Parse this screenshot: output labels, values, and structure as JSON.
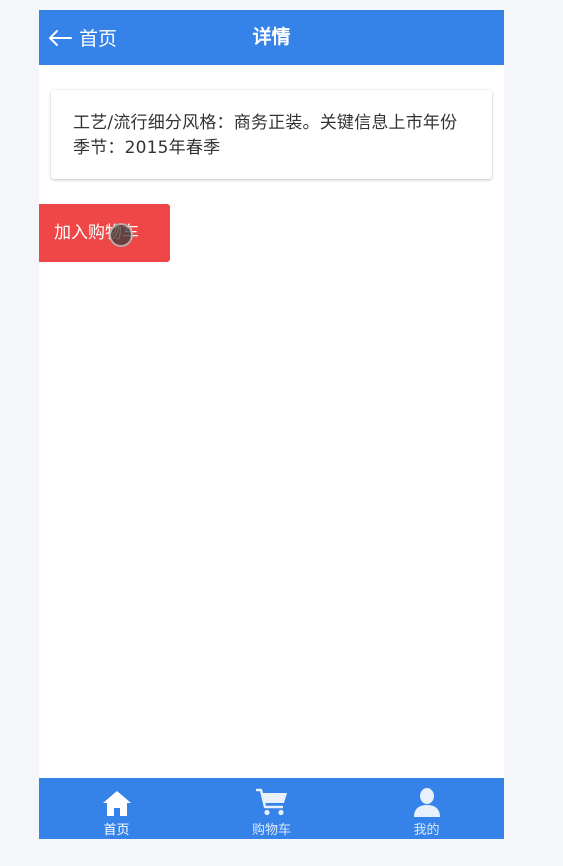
{
  "navbar": {
    "back_label": "首页",
    "title": "详情",
    "background": "#3582e9"
  },
  "detail": {
    "text": "工艺/流行细分风格：商务正装。关键信息上市年份季节：2015年春季"
  },
  "actions": {
    "add_to_cart_label": "加入购物车",
    "add_to_cart_color": "#ef4747"
  },
  "tabbar": {
    "tabs": [
      {
        "label": "首页",
        "icon": "home-icon",
        "active": true
      },
      {
        "label": "购物车",
        "icon": "cart-icon",
        "active": false
      },
      {
        "label": "我的",
        "icon": "user-icon",
        "active": false
      }
    ]
  }
}
